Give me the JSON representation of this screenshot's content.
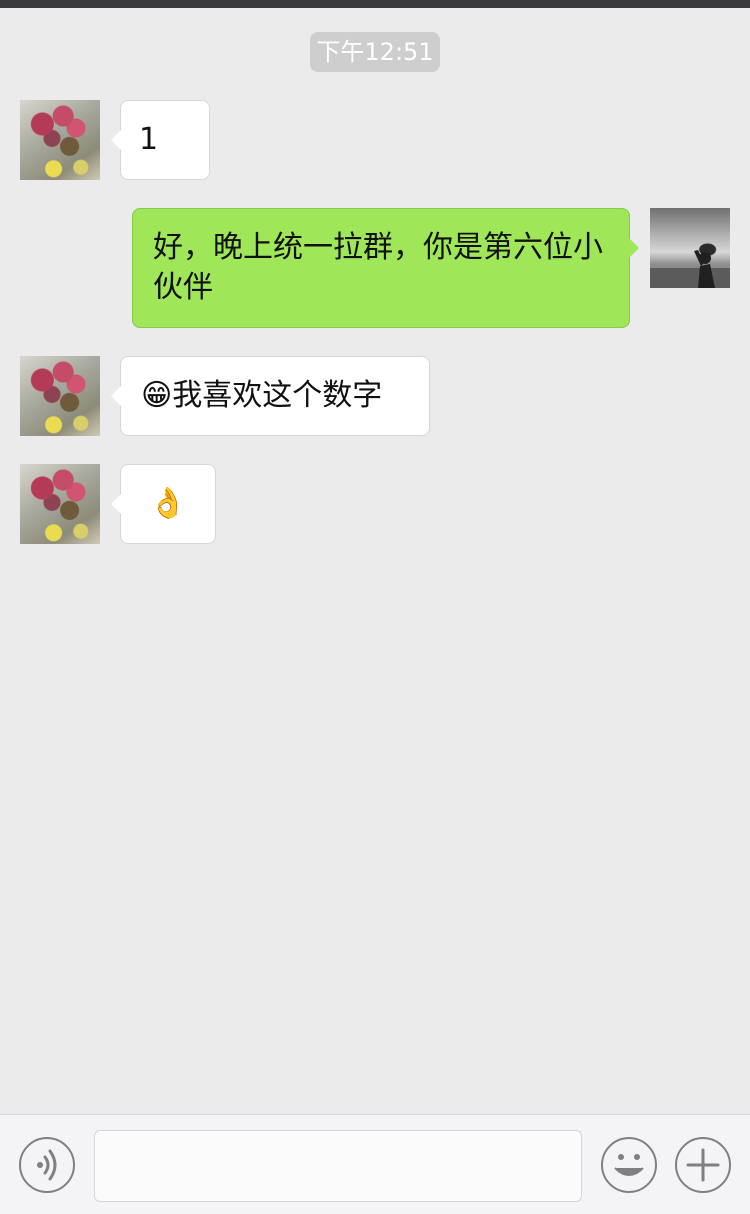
{
  "chat": {
    "timestamp": "下午12:51",
    "messages": [
      {
        "direction": "incoming",
        "avatar": "flower-painting-avatar",
        "text": "1"
      },
      {
        "direction": "outgoing",
        "avatar": "sky-photo-avatar",
        "text": "好，晚上统一拉群，你是第六位小伙伴"
      },
      {
        "direction": "incoming",
        "avatar": "flower-painting-avatar",
        "emoji": "😁",
        "text": "我喜欢这个数字"
      },
      {
        "direction": "incoming",
        "avatar": "flower-painting-avatar",
        "emoji": "👌"
      }
    ]
  },
  "input_bar": {
    "voice_icon": "voice-icon",
    "emoji_icon": "smile-icon",
    "more_icon": "plus-icon",
    "placeholder": ""
  },
  "colors": {
    "background": "#ebebeb",
    "outgoing_bubble": "#9fe658",
    "incoming_bubble": "#ffffff",
    "timestamp_chip": "#cecece"
  }
}
